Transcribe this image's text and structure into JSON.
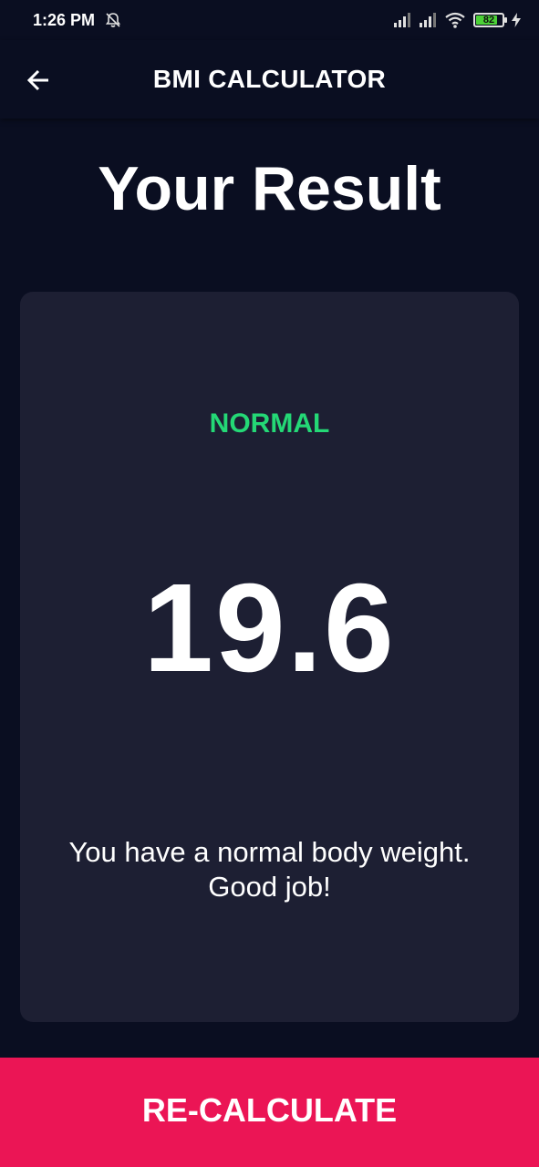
{
  "status_bar": {
    "time": "1:26 PM",
    "icons": [
      "bell-off-icon",
      "signal-icon",
      "signal-icon",
      "wifi-icon",
      "battery-icon",
      "charging-icon"
    ],
    "battery_level": "82",
    "battery_fraction": 0.82
  },
  "app_bar": {
    "back_icon": "arrow-left-icon",
    "title": "BMI CALCULATOR"
  },
  "main": {
    "heading": "Your Result"
  },
  "result": {
    "category": "NORMAL",
    "bmi": "19.6",
    "interpretation": "You have a normal body weight. Good job!"
  },
  "footer": {
    "button_label": "RE-CALCULATE"
  },
  "colors": {
    "background": "#0A0E21",
    "card": "#1D1F33",
    "normal_green": "#24D876",
    "accent_pink": "#EB1555",
    "battery_green": "#4CD137"
  }
}
